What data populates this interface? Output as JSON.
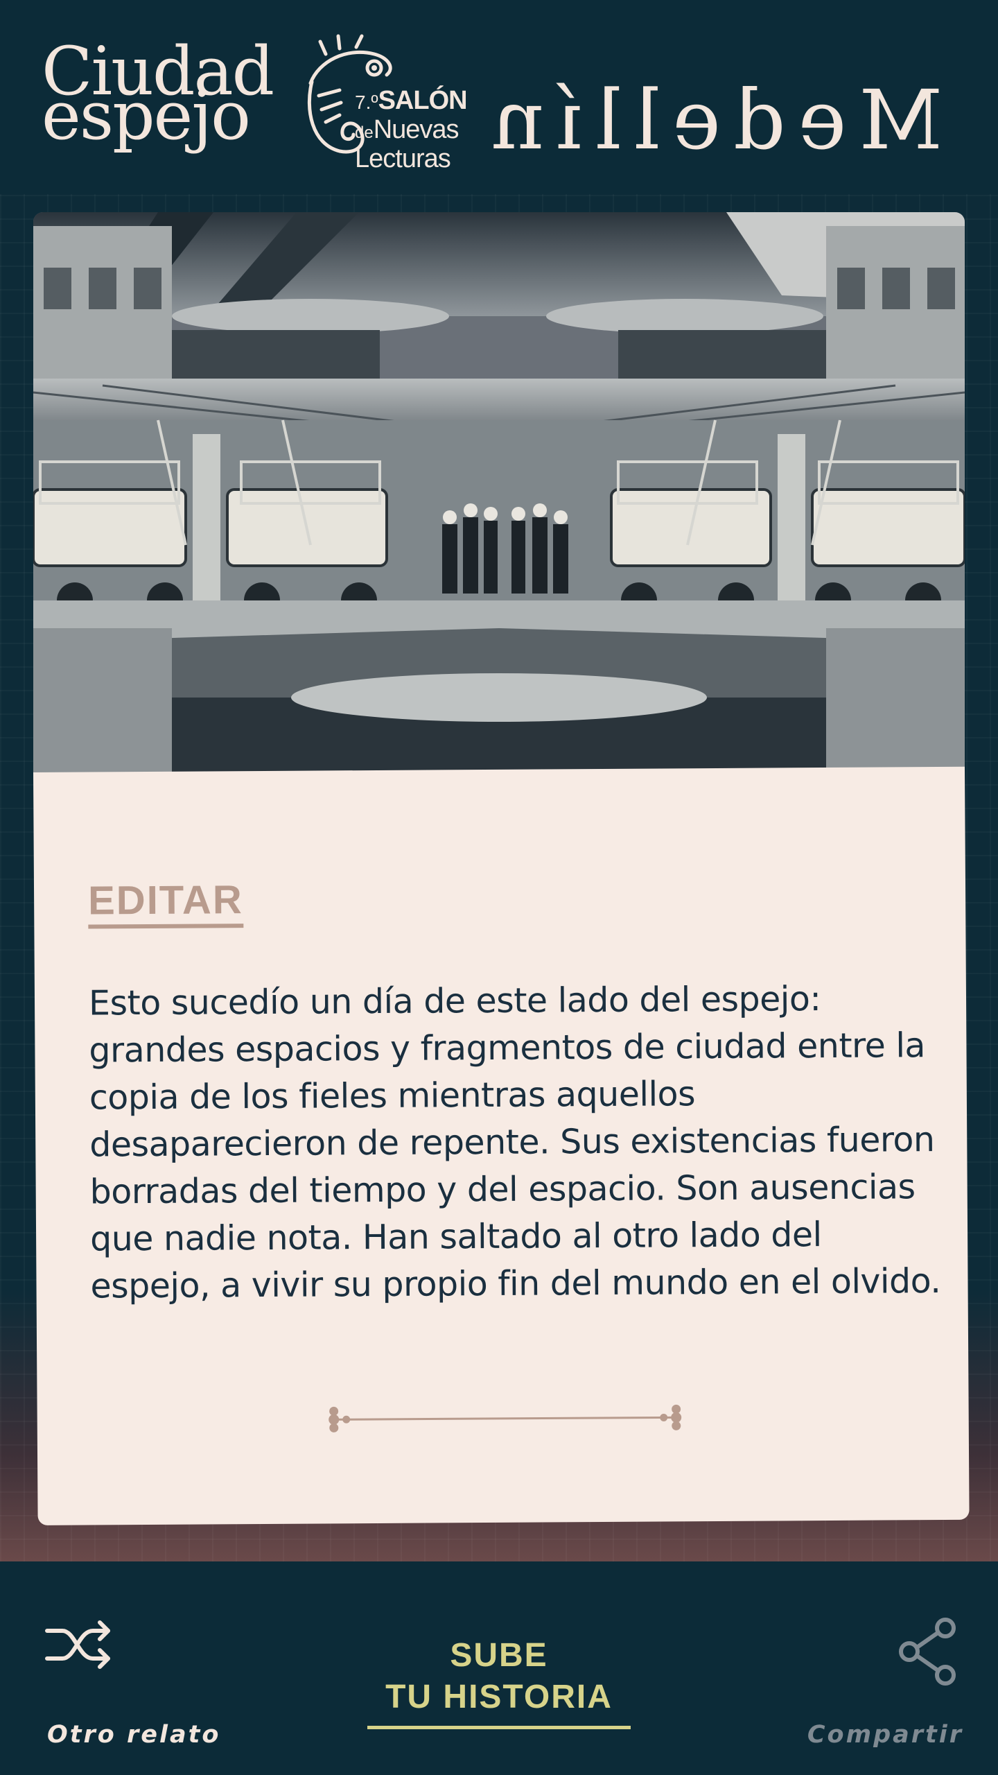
{
  "header": {
    "logo_ciudad_line1": "Ciudad",
    "logo_ciudad_line2": "espejo",
    "logo_salon_num": "7.º",
    "logo_salon_big": "SALÓN",
    "logo_salon_de": "de",
    "logo_salon_nuevas": "Nuevas",
    "logo_salon_lecturas": "Lecturas",
    "logo_city": "Medellín"
  },
  "card": {
    "edit_label": "EDITAR",
    "story": "Esto sucedío  un día de este lado del espejo: grandes espacios  y fragmentos de ciudad entre la copia de los fieles mientras aquellos desaparecieron de repente. Sus existencias fueron borradas del tiempo y del espacio. Son ausencias que nadie nota. Han saltado al otro lado del espejo, a vivir su propio fin del mundo en el olvido."
  },
  "bottom": {
    "shuffle_label": "Otro relato",
    "upload_line1": "SUBE",
    "upload_line2": "TU HISTORIA",
    "share_label": "Compartir"
  },
  "colors": {
    "background": "#0c2b38",
    "card": "#f7ebe4",
    "accent": "#d7d38a",
    "edit": "#b89b8d",
    "text": "#1a2f3f"
  }
}
